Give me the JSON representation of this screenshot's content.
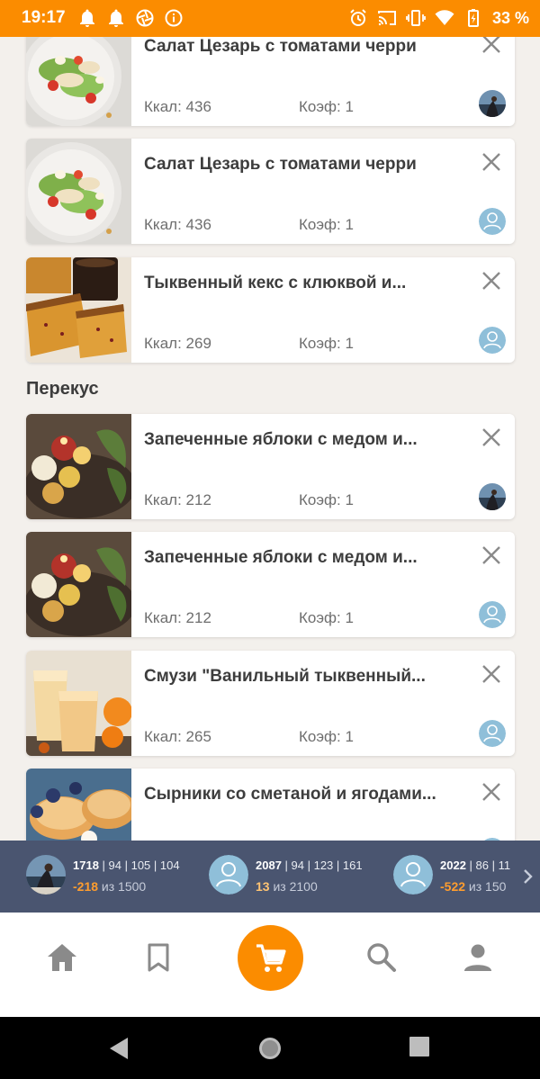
{
  "status_bar": {
    "time": "19:17",
    "battery": "33 %",
    "icons_left": [
      "bell-icon",
      "bell-icon",
      "aperture-icon",
      "info-icon"
    ],
    "icons_right": [
      "alarm-icon",
      "cast-icon",
      "vibrate-icon",
      "wifi-icon",
      "battery-icon"
    ]
  },
  "meals": [
    {
      "title": "Салат Цезарь с томатами черри",
      "kcal": "Ккал: 436",
      "koef": "Коэф: 1",
      "avatar": "photo",
      "image": "caesar-salad"
    },
    {
      "title": "Салат Цезарь с томатами черри",
      "kcal": "Ккал: 436",
      "koef": "Коэф: 1",
      "avatar": "default",
      "image": "caesar-salad"
    },
    {
      "title": "Тыквенный кекс с клюквой и...",
      "kcal": "Ккал: 269",
      "koef": "Коэф: 1",
      "avatar": "default",
      "image": "pumpkin-cake"
    }
  ],
  "section_snack": {
    "title": "Перекус",
    "items": [
      {
        "title": "Запеченные яблоки с медом и...",
        "kcal": "Ккал: 212",
        "koef": "Коэф: 1",
        "avatar": "photo",
        "image": "baked-apples"
      },
      {
        "title": "Запеченные яблоки с медом и...",
        "kcal": "Ккал: 212",
        "koef": "Коэф: 1",
        "avatar": "default",
        "image": "baked-apples"
      },
      {
        "title": "Смузи \"Ванильный тыквенный...",
        "kcal": "Ккал: 265",
        "koef": "Коэф: 1",
        "avatar": "default",
        "image": "smoothie"
      },
      {
        "title": "Сырники со сметаной и ягодами...",
        "kcal": "",
        "koef": "",
        "avatar": "default",
        "image": "syrniki"
      }
    ]
  },
  "users_panel": [
    {
      "total": "1718",
      "nutrients": " | 94 | 105 | 104",
      "diff": "-218",
      "of": " из 1500",
      "avatar": "photo"
    },
    {
      "total": "2087",
      "nutrients": " | 94 | 123 | 161",
      "diff": "13",
      "of": " из 2100",
      "avatar": "default"
    },
    {
      "total": "2022",
      "nutrients": " | 86 | 11",
      "diff": "-522",
      "of": " из 150",
      "avatar": "default"
    }
  ],
  "bottom_nav": [
    "home-icon",
    "bookmark-icon",
    "cart-icon",
    "search-icon",
    "profile-icon"
  ],
  "colors": {
    "accent": "#fb8c00",
    "panel": "#4a5570",
    "background": "#f3f0ec"
  }
}
